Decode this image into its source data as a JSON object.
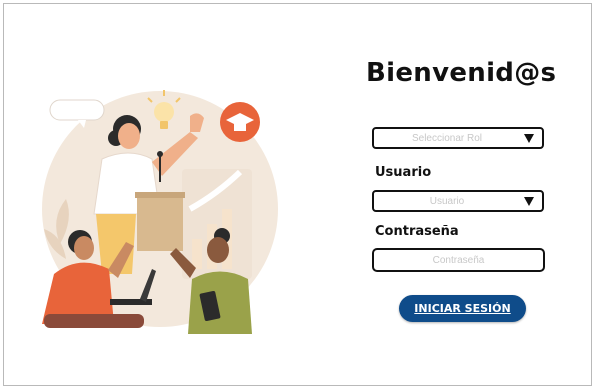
{
  "login": {
    "title": "Bienvenid@s",
    "role_select": {
      "placeholder": "Seleccionar Rol"
    },
    "username": {
      "label": "Usuario",
      "placeholder": "Usuario"
    },
    "password": {
      "label": "Contraseña",
      "placeholder": "Contraseña"
    },
    "submit_label": "INICIAR SESIÓN"
  },
  "colors": {
    "button_bg": "#0f4c8a",
    "placeholder_text": "#c8c8c8",
    "illustration_circle": "#f3e8dc",
    "illustration_accent": "#e8643a"
  },
  "illustration": {
    "icons": [
      "speech-bubble-icon",
      "lightbulb-icon",
      "graduation-cap-icon"
    ]
  }
}
